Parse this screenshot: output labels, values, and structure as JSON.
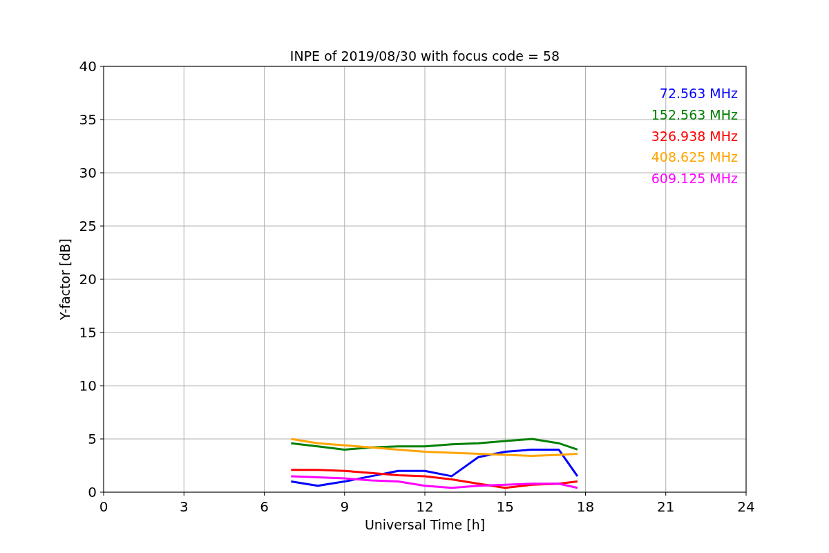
{
  "chart_data": {
    "type": "line",
    "title": "INPE of 2019/08/30 with focus code = 58",
    "xlabel": "Universal Time [h]",
    "ylabel": "Y-factor [dB]",
    "x": [
      7,
      8,
      9,
      10,
      11,
      12,
      13,
      14,
      15,
      16,
      17,
      17.7
    ],
    "series": [
      {
        "name": "72.563 MHz",
        "color": "#0000ff",
        "values": [
          1,
          0.6,
          1,
          1.5,
          2,
          2,
          1.5,
          3.3,
          3.8,
          4,
          4,
          1.5
        ]
      },
      {
        "name": "152.563 MHz",
        "color": "#008000",
        "values": [
          4.6,
          4.3,
          4,
          4.2,
          4.3,
          4.3,
          4.5,
          4.6,
          4.8,
          5,
          4.6,
          4
        ]
      },
      {
        "name": "326.938 MHz",
        "color": "#ff0000",
        "values": [
          2.1,
          2.1,
          2,
          1.8,
          1.6,
          1.5,
          1.2,
          0.8,
          0.4,
          0.7,
          0.8,
          1
        ]
      },
      {
        "name": "408.625 MHz",
        "color": "#ffa500",
        "values": [
          5,
          4.6,
          4.4,
          4.2,
          4,
          3.8,
          3.7,
          3.6,
          3.5,
          3.4,
          3.5,
          3.6
        ]
      },
      {
        "name": "609.125 MHz",
        "color": "#ff00ff",
        "values": [
          1.5,
          1.4,
          1.3,
          1.1,
          1,
          0.6,
          0.4,
          0.6,
          0.7,
          0.8,
          0.8,
          0.4
        ]
      }
    ],
    "grid": true,
    "xlim": [
      0,
      24
    ],
    "ylim": [
      0,
      40
    ],
    "xticks": [
      0,
      3,
      6,
      9,
      12,
      15,
      18,
      21,
      24
    ],
    "yticks": [
      0,
      5,
      10,
      15,
      20,
      25,
      30,
      35,
      40
    ]
  }
}
